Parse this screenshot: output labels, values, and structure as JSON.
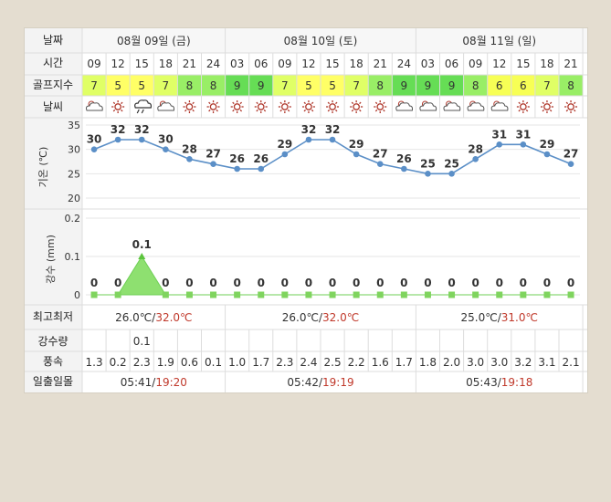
{
  "row_labels": {
    "date": "날짜",
    "time": "시간",
    "golf_index": "골프지수",
    "weather": "날씨",
    "temp_axis": "기온 (℃)",
    "precip_axis": "강수 (mm)",
    "minmax": "최고최저",
    "precip": "강수량",
    "wind": "풍속",
    "sun": "일출일몰"
  },
  "days": [
    {
      "label": "08월 09일 (금)",
      "min": "26.0℃",
      "max": "32.0℃",
      "sunrise": "05:41",
      "sunset": "19:20"
    },
    {
      "label": "08월 10일 (토)",
      "min": "26.0℃",
      "max": "32.0℃",
      "sunrise": "05:42",
      "sunset": "19:19"
    },
    {
      "label": "08월 11일 (일)",
      "min": "25.0℃",
      "max": "31.0℃",
      "sunrise": "05:43",
      "sunset": "19:18"
    }
  ],
  "hours": [
    "09",
    "12",
    "15",
    "18",
    "21",
    "24",
    "03",
    "06",
    "09",
    "12",
    "15",
    "18",
    "21",
    "24",
    "03",
    "06",
    "09",
    "12",
    "15",
    "18",
    "21"
  ],
  "golf_index": [
    7,
    5,
    5,
    7,
    8,
    8,
    9,
    9,
    7,
    5,
    5,
    7,
    8,
    9,
    9,
    9,
    8,
    6,
    6,
    7,
    8
  ],
  "weather_icons": [
    "partly-cloudy-icon",
    "sun-icon",
    "rain-shower-icon",
    "partly-cloudy-icon",
    "sun-icon",
    "sun-icon",
    "sun-icon",
    "sun-icon",
    "sun-icon",
    "sun-icon",
    "sun-icon",
    "sun-icon",
    "sun-icon",
    "partly-cloudy-icon",
    "partly-cloudy-icon",
    "partly-cloudy-icon",
    "partly-cloudy-icon",
    "partly-cloudy-icon",
    "sun-icon",
    "sun-icon",
    "sun-icon"
  ],
  "precip_values": [
    "",
    "",
    "0.1",
    "",
    "",
    "",
    "",
    "",
    "",
    "",
    "",
    "",
    "",
    "",
    "",
    "",
    "",
    "",
    "",
    "",
    ""
  ],
  "wind": [
    "1.3",
    "0.2",
    "2.3",
    "1.9",
    "0.6",
    "0.1",
    "1.0",
    "1.7",
    "2.3",
    "2.4",
    "2.5",
    "2.2",
    "1.6",
    "1.7",
    "1.8",
    "2.0",
    "3.0",
    "3.0",
    "3.2",
    "3.1",
    "2.1"
  ],
  "colors": {
    "golf_5": "#ffff66",
    "golf_6": "#f7ff55",
    "golf_7": "#e0ff66",
    "golf_8": "#99ee66",
    "golf_9": "#66dd55",
    "line": "#5b8fc7",
    "precip": "#8ee070",
    "sun_icon": "#b03a2e",
    "max_temp": "#c0392b"
  },
  "chart_data": [
    {
      "type": "line",
      "x": [
        "09",
        "12",
        "15",
        "18",
        "21",
        "24",
        "03",
        "06",
        "09",
        "12",
        "15",
        "18",
        "21",
        "24",
        "03",
        "06",
        "09",
        "12",
        "15",
        "18",
        "21"
      ],
      "series": [
        {
          "values": [
            30,
            32,
            32,
            30,
            28,
            27,
            26,
            26,
            29,
            32,
            32,
            29,
            27,
            26,
            25,
            25,
            28,
            31,
            31,
            29,
            27
          ]
        }
      ],
      "ylabel": "기온 (℃)",
      "ylim": [
        20,
        35
      ],
      "yticks": [
        20,
        25,
        30,
        35
      ],
      "grid": true
    },
    {
      "type": "area",
      "x": [
        "09",
        "12",
        "15",
        "18",
        "21",
        "24",
        "03",
        "06",
        "09",
        "12",
        "15",
        "18",
        "21",
        "24",
        "03",
        "06",
        "09",
        "12",
        "15",
        "18",
        "21"
      ],
      "series": [
        {
          "values": [
            0,
            0,
            0.1,
            0,
            0,
            0,
            0,
            0,
            0,
            0,
            0,
            0,
            0,
            0,
            0,
            0,
            0,
            0,
            0,
            0,
            0
          ]
        }
      ],
      "ylabel": "강수 (mm)",
      "ylim": [
        0,
        0.2
      ],
      "yticks": [
        0,
        0.1,
        0.2
      ],
      "grid": true
    }
  ]
}
